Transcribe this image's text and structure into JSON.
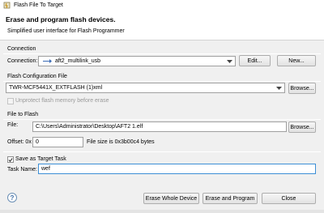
{
  "window": {
    "title": "Flash File To Target",
    "icon": "flash-file-icon"
  },
  "header": {
    "title": "Erase and program flash devices.",
    "subtitle": "Simplified user interface for Flash Programmer"
  },
  "connection": {
    "section_label": "Connection",
    "field_label": "Connection:",
    "value": "aft2_multilink_usb",
    "edit_label": "Edit...",
    "new_label": "New..."
  },
  "flash_config": {
    "section_label": "Flash Configuration File",
    "value": "TWR-MCF5441X_EXTFLASH (1)xml",
    "browse_label": "Browse...",
    "unprotect_label": "Unprotect flash memory before erase",
    "unprotect_checked": false
  },
  "file_to_flash": {
    "section_label": "File to Flash",
    "file_label": "File:",
    "file_value": "C:\\Users\\Administrator\\Desktop\\AFT2 1.elf",
    "browse_label": "Browse...",
    "offset_label": "Offset: 0x",
    "offset_value": "0",
    "size_text": "File size is 0x3b00c4 bytes"
  },
  "save_task": {
    "checkbox_label": "Save as Target Task",
    "checked": true,
    "task_name_label": "Task Name:",
    "task_name_value": "wef"
  },
  "footer": {
    "help_label": "?",
    "erase_label": "Erase Whole Device",
    "erase_program_label": "Erase and Program",
    "close_label": "Close"
  },
  "colors": {
    "focus_border": "#3c8fd6",
    "help_blue": "#3d6ea6"
  }
}
